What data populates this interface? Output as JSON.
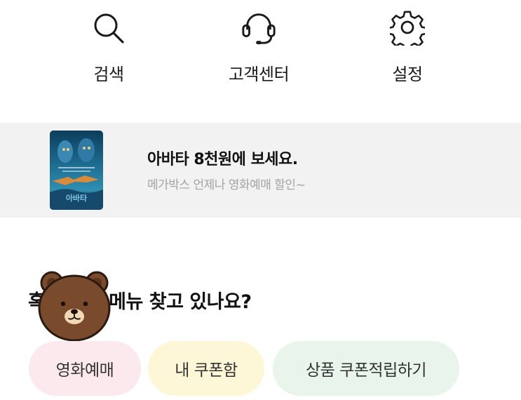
{
  "quick_menu": {
    "items": [
      {
        "label": "검색",
        "icon": "search-icon"
      },
      {
        "label": "고객센터",
        "icon": "headset-icon"
      },
      {
        "label": "설정",
        "icon": "gear-icon"
      }
    ]
  },
  "banner": {
    "title": "아바타 8천원에 보세요.",
    "subtitle": "메가박스 언제나 영화예매 할인~",
    "poster_text": "아바타"
  },
  "suggestion": {
    "question": "혹시 이런 메뉴 찾고 있나요?",
    "chips": [
      {
        "label": "영화예매",
        "color": "#fbe9ee"
      },
      {
        "label": "내 쿠폰함",
        "color": "#fdf7d8"
      },
      {
        "label": "상품 쿠폰적립하기",
        "color": "#e9f5ea"
      }
    ]
  }
}
